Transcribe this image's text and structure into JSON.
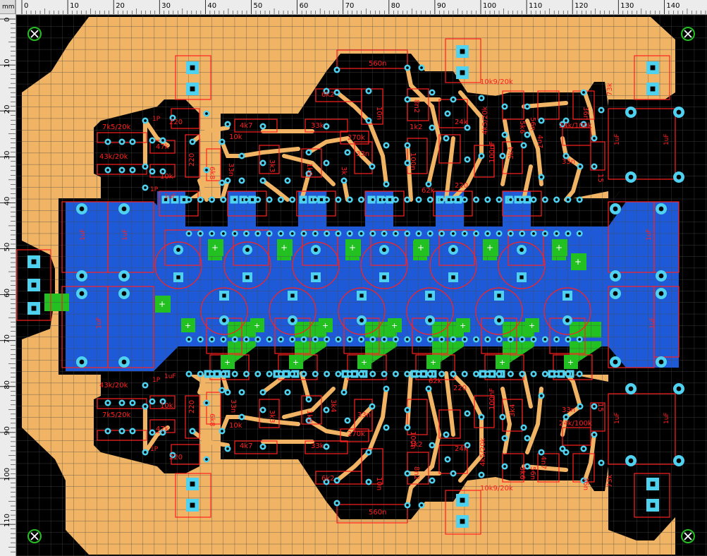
{
  "app": {
    "units": "mm"
  },
  "colors": {
    "background": "#000000",
    "copper_top": "#f0b464",
    "copper_bottom": "#1e5ad8",
    "copper_green": "#22c020",
    "pad": "#4ed2f0",
    "outline": "#ff2020",
    "grid": "#4a4a4a"
  },
  "rulers": {
    "top": [
      "0",
      "10",
      "20",
      "30",
      "40",
      "50",
      "60",
      "70",
      "80",
      "90",
      "100",
      "110",
      "120",
      "130",
      "140"
    ],
    "left": [
      "0",
      "10",
      "20",
      "30",
      "40",
      "50",
      "60",
      "70",
      "80",
      "90",
      "100",
      "110"
    ]
  },
  "markers": {
    "count": 4,
    "icon": "circle-x-icon"
  },
  "labels": [
    {
      "text": "560n",
      "size": 10
    },
    {
      "text": "6k2",
      "size": 10
    },
    {
      "text": "10n",
      "size": 10
    },
    {
      "text": "8n2",
      "size": 10
    },
    {
      "text": "1k2",
      "size": 10
    },
    {
      "text": "10k9/20k",
      "size": 10
    },
    {
      "text": "24k",
      "size": 10
    },
    {
      "text": "4k5/20k",
      "size": 10
    },
    {
      "text": "56n",
      "size": 10
    },
    {
      "text": "36n",
      "size": 10
    },
    {
      "text": "73k",
      "size": 10
    },
    {
      "text": "7k5/20k",
      "size": 10
    },
    {
      "text": "220",
      "size": 10
    },
    {
      "text": "4k7",
      "size": 10
    },
    {
      "text": "10k",
      "size": 10
    },
    {
      "text": "33k",
      "size": 10
    },
    {
      "text": "270k",
      "size": 10
    },
    {
      "text": "100n",
      "size": 10
    },
    {
      "text": "43k/20k",
      "size": 10
    },
    {
      "text": "47k",
      "size": 10
    },
    {
      "text": "1P",
      "size": 9
    },
    {
      "text": "6k8",
      "size": 10
    },
    {
      "text": "33n",
      "size": 10
    },
    {
      "text": "3k3",
      "size": 10
    },
    {
      "text": "1k8",
      "size": 10
    },
    {
      "text": "15",
      "size": 10
    },
    {
      "text": "24k/100k",
      "size": 10
    },
    {
      "text": "62k",
      "size": 10
    },
    {
      "text": "100nF",
      "size": 10
    },
    {
      "text": "3k4",
      "size": 10
    },
    {
      "text": "5k6",
      "size": 10
    },
    {
      "text": "4n7",
      "size": 10
    },
    {
      "text": "1uF",
      "size": 9
    }
  ]
}
